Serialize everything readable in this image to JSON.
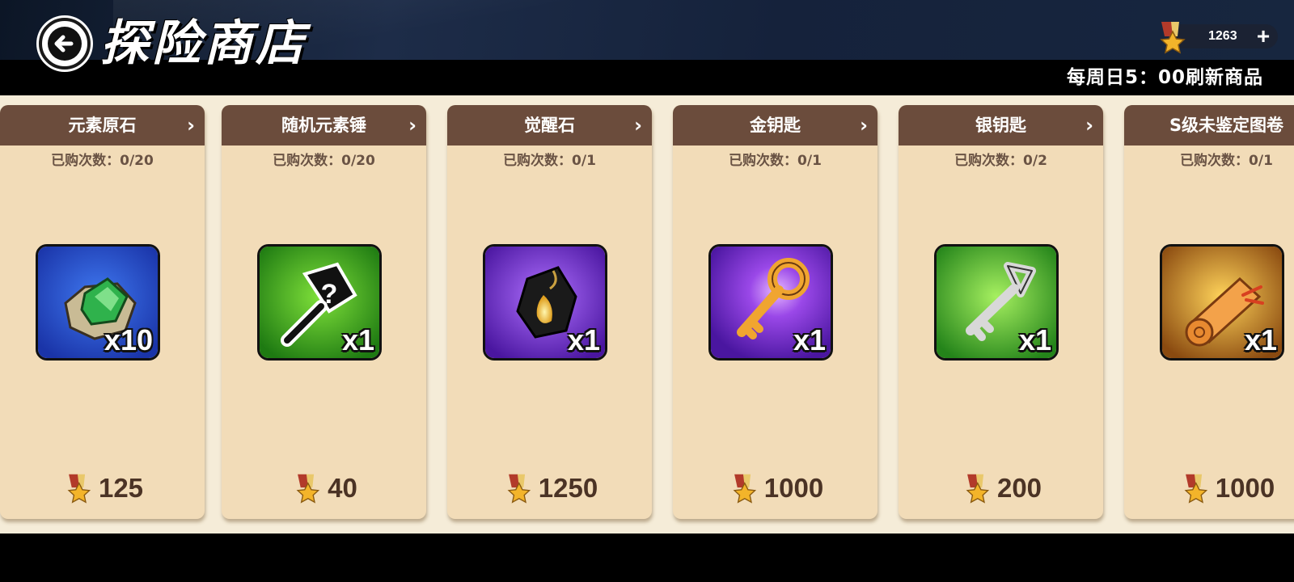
{
  "header": {
    "title": "探险商店",
    "currency_amount": "1263",
    "refresh_note": "每周日5：00刷新商品"
  },
  "shop": {
    "items": [
      {
        "name": "元素原石",
        "purchased": "已购次数：0/20",
        "quantity": "x10",
        "price": "125",
        "icon": "element-ore-icon",
        "bg": "#2048c8"
      },
      {
        "name": "随机元素锤",
        "purchased": "已购次数：0/20",
        "quantity": "x1",
        "price": "40",
        "icon": "mystery-hammer-icon",
        "bg": "#2f9a1e"
      },
      {
        "name": "觉醒石",
        "purchased": "已购次数：0/1",
        "quantity": "x1",
        "price": "1250",
        "icon": "awakening-stone-icon",
        "bg": "#6a26c8"
      },
      {
        "name": "金钥匙",
        "purchased": "已购次数：0/1",
        "quantity": "x1",
        "price": "1000",
        "icon": "gold-key-icon",
        "bg": "#7a2ad0"
      },
      {
        "name": "银钥匙",
        "purchased": "已购次数：0/2",
        "quantity": "x1",
        "price": "200",
        "icon": "silver-key-icon",
        "bg": "#3aa224"
      },
      {
        "name": "S级未鉴定图卷",
        "purchased": "已购次数：0/1",
        "quantity": "x1",
        "price": "1000",
        "icon": "scroll-icon",
        "bg": "#c7801a"
      }
    ]
  },
  "colors": {
    "card_header": "#6b4c3c",
    "card_body": "#f2dcb8",
    "price_text": "#4b3325"
  }
}
